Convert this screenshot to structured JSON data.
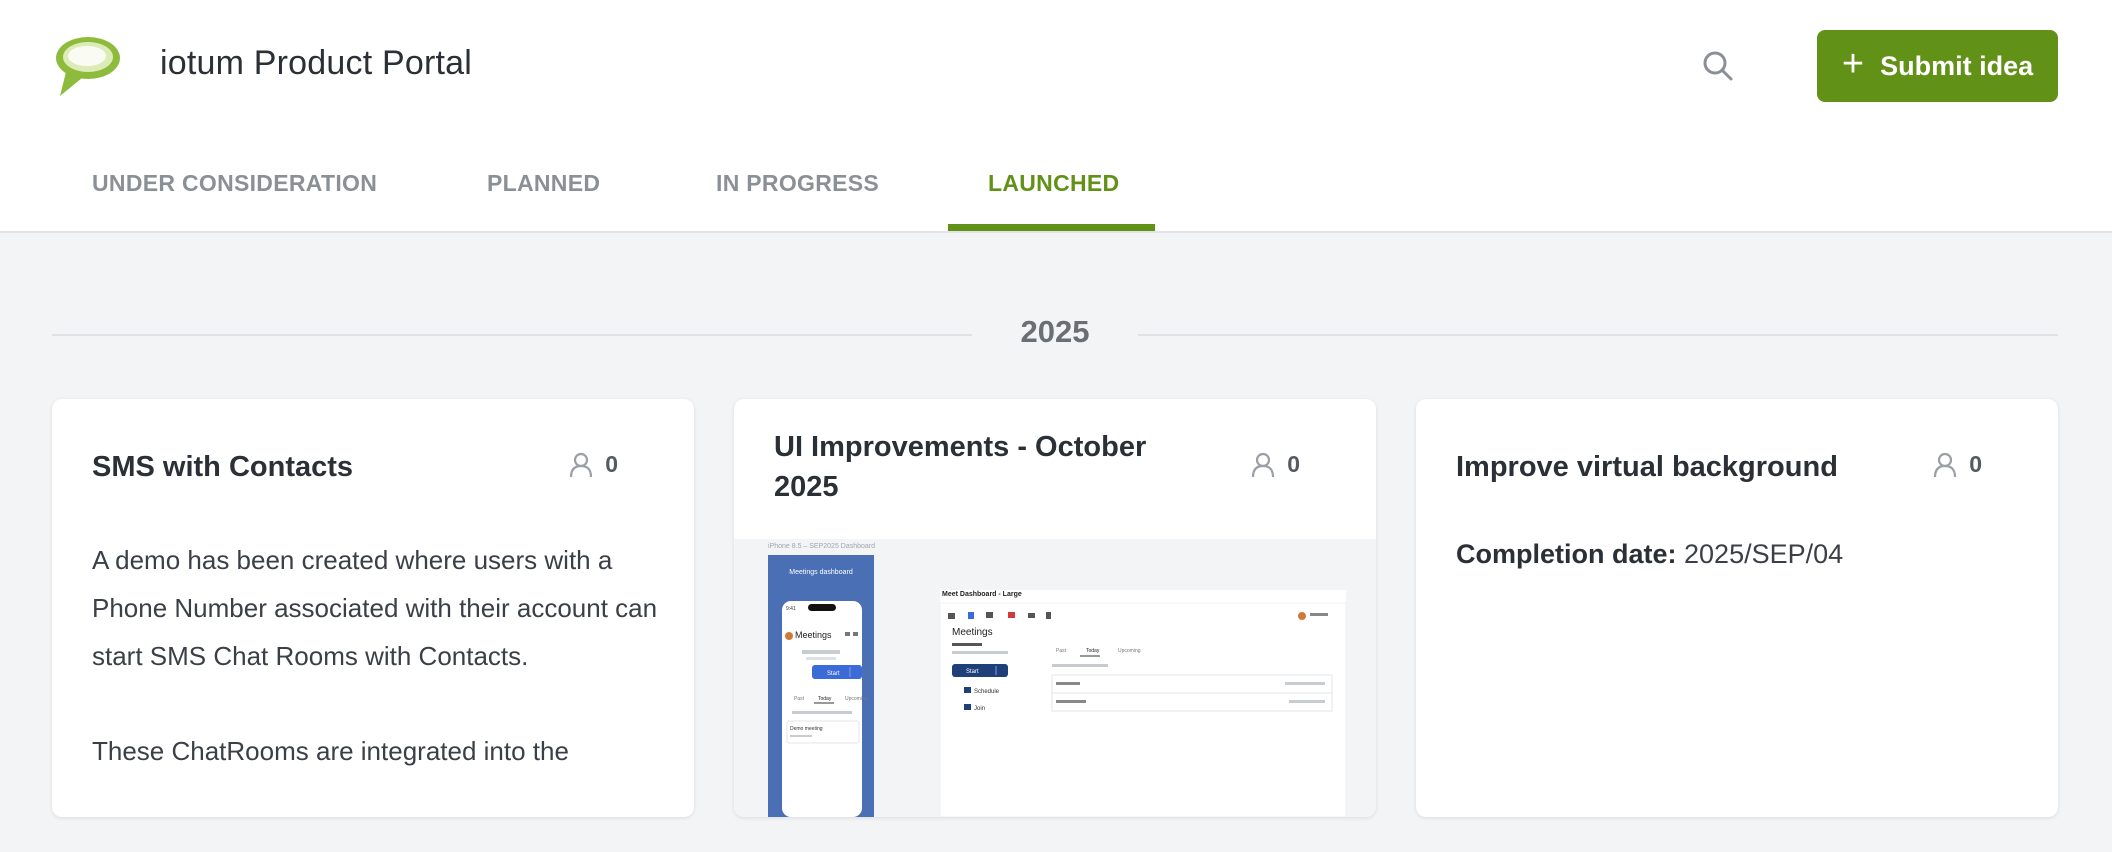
{
  "header": {
    "title": "iotum Product Portal",
    "submit_label": "Submit idea",
    "brand_color": "#629118"
  },
  "tabs": [
    {
      "label": "UNDER CONSIDERATION",
      "active": false
    },
    {
      "label": "PLANNED",
      "active": false
    },
    {
      "label": "IN PROGRESS",
      "active": false
    },
    {
      "label": "LAUNCHED",
      "active": true
    }
  ],
  "section": {
    "year": "2025"
  },
  "cards": [
    {
      "title": "SMS with Contacts",
      "votes": "0",
      "body": [
        "A demo has been created where users with a Phone Number associated with their account can start SMS Chat Rooms with Contacts.",
        "These ChatRooms are integrated into the"
      ]
    },
    {
      "title": "UI Improvements - October 2025",
      "votes": "0",
      "image": {
        "caption": "iPhone 8.5 – SEP2025 Dashboard",
        "phone_header": "Meetings dashboard",
        "phone_time": "9:41",
        "phone_title": "Meetings",
        "phone_start": "Start",
        "phone_tabs": [
          "Past",
          "Today",
          "Upcoming"
        ],
        "phone_item": "Demo meeting",
        "desktop_label": "Meet Dashboard - Large",
        "desktop_title": "Meetings",
        "desktop_start": "Start",
        "desktop_schedule": "Schedule",
        "desktop_join": "Join",
        "desktop_tabs": [
          "Past",
          "Today",
          "Upcoming"
        ]
      }
    },
    {
      "title": "Improve virtual background",
      "votes": "0",
      "completion_label": "Completion date:",
      "completion_value": "2025/SEP/04"
    }
  ]
}
